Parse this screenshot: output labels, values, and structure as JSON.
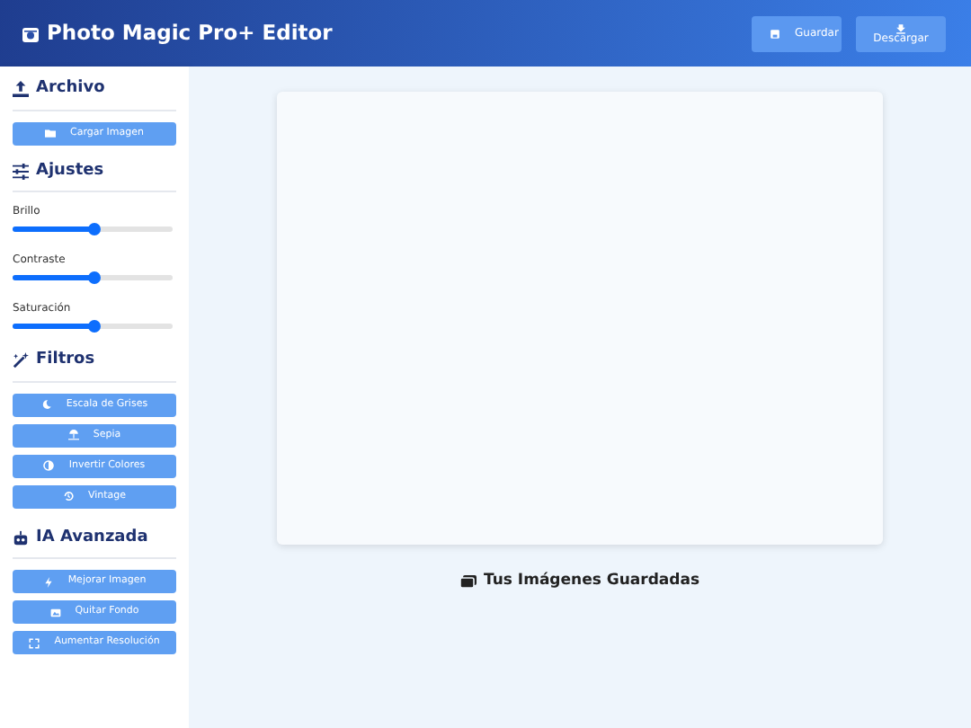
{
  "header": {
    "title": "Photo Magic Pro+ Editor",
    "buttons": [
      {
        "label": "Guardar",
        "kind": "inline"
      },
      {
        "label": "Descargar",
        "kind": "stacked"
      }
    ]
  },
  "sidebar": {
    "sections": [
      {
        "title": "Archivo",
        "controls": [
          {
            "kind": "button",
            "label": "Cargar Imagen"
          }
        ]
      },
      {
        "title": "Ajustes",
        "controls": [
          {
            "kind": "slider",
            "label": "Brillo",
            "level": 0.5
          },
          {
            "kind": "slider",
            "label": "Contraste",
            "level": 0.5
          },
          {
            "kind": "slider",
            "label": "Saturación",
            "level": 0.5
          }
        ]
      },
      {
        "title": "Filtros",
        "controls": [
          {
            "kind": "button",
            "label": "Escala de Grises"
          },
          {
            "kind": "button",
            "label": "Sepia"
          },
          {
            "kind": "button",
            "label": "Invertir Colores"
          },
          {
            "kind": "button",
            "label": "Vintage"
          }
        ]
      },
      {
        "title": "IA Avanzada",
        "controls": [
          {
            "kind": "button",
            "label": "Mejorar Imagen"
          },
          {
            "kind": "button",
            "label": "Quitar Fondo"
          },
          {
            "kind": "button",
            "label": "Aumentar Resolución"
          }
        ]
      }
    ]
  },
  "gallery": {
    "title": "Tus Imágenes Guardadas"
  }
}
